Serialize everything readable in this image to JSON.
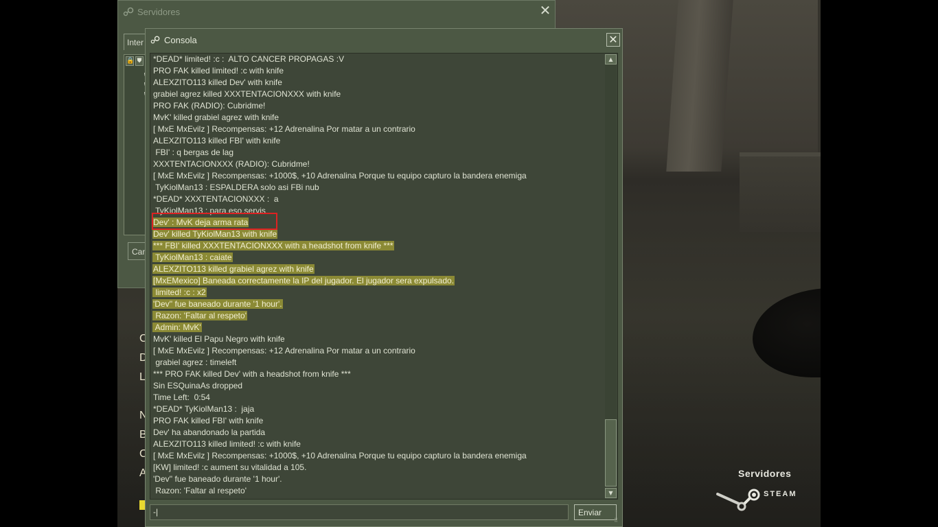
{
  "servers_window": {
    "title": "Servidores",
    "tab_label": "Inter",
    "cancel_label": "Can",
    "close_glyph": "✕"
  },
  "game_menu": {
    "items": [
      "C",
      "D",
      "L",
      "N",
      "B",
      "C",
      "A"
    ]
  },
  "console": {
    "title": "Consola",
    "close_glyph": "✕",
    "lines": [
      {
        "text": "*DEAD* limited! :c :  ALTO CANCER PROPAGAS :V",
        "highlight": false
      },
      {
        "text": "PRO FAK killed limited! :c with knife",
        "highlight": false
      },
      {
        "text": "ALEXZITO113 killed Dev' with knife",
        "highlight": false
      },
      {
        "text": "grabiel agrez killed XXXTENTACIONXXX with knife",
        "highlight": false
      },
      {
        "text": "PRO FAK (RADIO): Cubridme!",
        "highlight": false
      },
      {
        "text": "MvK' killed grabiel agrez with knife",
        "highlight": false
      },
      {
        "text": "[ MxE MxEvilz ] Recompensas: +12 Adrenalina Por matar a un contrario",
        "highlight": false
      },
      {
        "text": "ALEXZITO113 killed FBI' with knife",
        "highlight": false
      },
      {
        "text": " FBI' : q bergas de lag",
        "highlight": false
      },
      {
        "text": "XXXTENTACIONXXX (RADIO): Cubridme!",
        "highlight": false
      },
      {
        "text": "[ MxE MxEvilz ] Recompensas: +1000$, +10 Adrenalina Porque tu equipo capturo la bandera enemiga",
        "highlight": false
      },
      {
        "text": " TyKiolMan13 : ESPALDERA solo asi FBi nub",
        "highlight": false
      },
      {
        "text": "*DEAD* XXXTENTACIONXXX :  a",
        "highlight": false
      },
      {
        "text": " TyKiolMan13 : para eso servis",
        "highlight": false
      },
      {
        "text": "Dev' : MvK deja arma rata",
        "highlight": true
      },
      {
        "text": "Dev' killed TyKiolMan13 with knife",
        "highlight": true
      },
      {
        "text": "*** FBI' killed XXXTENTACIONXXX with a headshot from knife ***",
        "highlight": true
      },
      {
        "text": " TyKiolMan13 : caiate",
        "highlight": true
      },
      {
        "text": "ALEXZITO113 killed grabiel agrez with knife",
        "highlight": true
      },
      {
        "text": "[MxEMexico] Baneada correctamente la IP del jugador. El jugador sera expulsado.",
        "highlight": true
      },
      {
        "text": " limited! :c : x2",
        "highlight": true
      },
      {
        "text": "'Dev'' fue baneado durante '1 hour'.",
        "highlight": true
      },
      {
        "text": " Razon: 'Faltar al respeto'",
        "highlight": true
      },
      {
        "text": " Admin: MvK'",
        "highlight": true
      },
      {
        "text": "MvK' killed El Papu Negro with knife",
        "highlight": false
      },
      {
        "text": "[ MxE MxEvilz ] Recompensas: +12 Adrenalina Por matar a un contrario",
        "highlight": false
      },
      {
        "text": " grabiel agrez : timeleft",
        "highlight": false
      },
      {
        "text": "*** PRO FAK killed Dev' with a headshot from knife ***",
        "highlight": false
      },
      {
        "text": "Sin ESQuinaAs dropped",
        "highlight": false
      },
      {
        "text": "Time Left:  0:54",
        "highlight": false
      },
      {
        "text": "*DEAD* TyKiolMan13 :  jaja",
        "highlight": false
      },
      {
        "text": "PRO FAK killed FBI' with knife",
        "highlight": false
      },
      {
        "text": "Dev' ha abandonado la partida",
        "highlight": false
      },
      {
        "text": "ALEXZITO113 killed limited! :c with knife",
        "highlight": false
      },
      {
        "text": "[ MxE MxEvilz ] Recompensas: +1000$, +10 Adrenalina Porque tu equipo capturo la bandera enemiga",
        "highlight": false
      },
      {
        "text": "[KW] limited! :c aument su vitalidad a 105.",
        "highlight": false
      },
      {
        "text": "'Dev'' fue baneado durante '1 hour'.",
        "highlight": false
      },
      {
        "text": " Razon: 'Faltar al respeto'",
        "highlight": false
      }
    ],
    "input_value": "-|",
    "send_label": "Enviar"
  },
  "overlay": {
    "servers_label": "Servidores",
    "steam_label": "STEAM"
  },
  "colors": {
    "panel": "#4c5844",
    "console_bg": "#3e4638",
    "highlight": "#8b8a35",
    "annotation_red": "#dd2222"
  }
}
